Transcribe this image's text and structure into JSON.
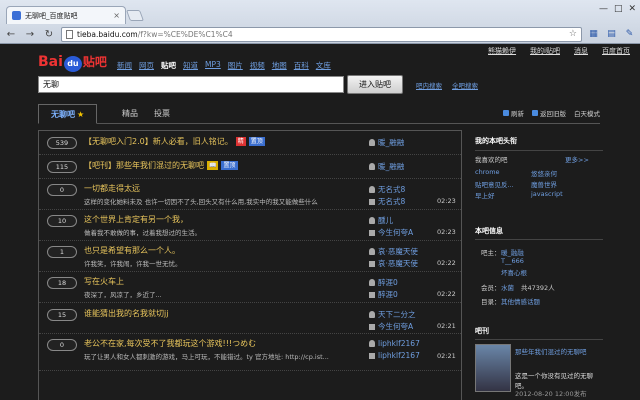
{
  "browser": {
    "tab_title": "无聊吧_百度贴吧",
    "tab_close": "×",
    "url_host": "tieba.baidu.com",
    "url_path": "/f?kw=%CE%DE%C1%C4",
    "win_min": "—",
    "win_max": "□",
    "win_close": "✕",
    "back_glyph": "←",
    "forward_glyph": "→",
    "reload_glyph": "↻",
    "star_glyph": "☆"
  },
  "userbar": [
    "熊猫赖伊",
    "我的i贴吧",
    "消息",
    "百度首页"
  ],
  "logo": {
    "bai": "Bai",
    "du": "du",
    "tieba": "贴吧"
  },
  "nav": [
    "新闻",
    "网页",
    "贴吧",
    "知道",
    "MP3",
    "图片",
    "视频",
    "地图",
    "百科",
    "文库"
  ],
  "nav_current": "贴吧",
  "search": {
    "value": "无聊",
    "button": "进入贴吧",
    "links": [
      "吧内搜索",
      "全吧搜索"
    ]
  },
  "forum_tabs": {
    "active": "无聊吧",
    "star": "★",
    "good": "精品",
    "vote": "投票"
  },
  "tab_tools": [
    "刷新",
    "返回旧版",
    "白天模式"
  ],
  "threads": [
    {
      "count": "539",
      "title": "【无聊吧入门2.0】新人必看，旧人铭记。",
      "tags": [
        {
          "t": "精",
          "c": "red"
        },
        {
          "t": "置顶",
          "c": "blue"
        }
      ],
      "sub": "",
      "author": "暖_融融",
      "reply": "",
      "time": ""
    },
    {
      "count": "115",
      "title": "【吧刊】那些年我们混过的无聊吧",
      "tags": [
        {
          "t": "📖",
          "c": "book"
        },
        {
          "t": "置顶",
          "c": "blue2"
        }
      ],
      "sub": "",
      "author": "暖_融融",
      "reply": "",
      "time": ""
    },
    {
      "count": "0",
      "title": "一切都走得太远",
      "tags": [],
      "sub": "这样的变化她料未及 也许一切因不了头,回头又有什么用,我实中的我又能做些什么",
      "author": "无名式8",
      "reply": "无名式8",
      "time": "02:23"
    },
    {
      "count": "10",
      "title": "这个世界上肯定有另一个我，",
      "tags": [],
      "sub": "做着我不敢做的事，过着我想过的生活。",
      "author": "醺儿",
      "reply": "今生何夸A",
      "time": "02:23"
    },
    {
      "count": "1",
      "title": "也只是希望有那么一个人。",
      "tags": [],
      "sub": "许我笑，许我闹，许我一世无忧。",
      "author": "哀·恶魔天使",
      "reply": "哀·恶魔天使",
      "time": "02:22"
    },
    {
      "count": "18",
      "title": "写在火车上",
      "tags": [],
      "sub": "夜深了，风凉了，乡近了...",
      "author": "醉涯0",
      "reply": "醉涯0",
      "time": "02:22"
    },
    {
      "count": "15",
      "title": "谁能猜出我的名我就切jj",
      "tags": [],
      "sub": "",
      "author": "天下二分之",
      "reply": "今生何夸A",
      "time": "02:21"
    },
    {
      "count": "0",
      "title": "老公不在家,每次受不了我都玩这个游戏!!!つめむ",
      "tags": [],
      "sub": "玩了让男人和女人都刺激的游戏，马上可玩，不能错过。ty 官方地址: http://cp.ist...",
      "author": "liphklf2167",
      "reply": "liphklf2167",
      "time": "02:21"
    }
  ],
  "side": {
    "my_header": "我的本吧头衔",
    "fav_label": "我喜欢的吧",
    "more": "更多>>",
    "favs": [
      "chrome",
      "悠悠亲何",
      "贴吧意见反...",
      "魔兽世界",
      "早上好",
      "javascript"
    ],
    "info_header": "本吧信息",
    "owner_label": "吧主：",
    "owners": [
      "暖_融融",
      "T__666",
      "坏喜心根"
    ],
    "member_label": "会员：",
    "member_name": "水菌",
    "member_count": "共47392人",
    "dir_label": "目录：",
    "dir_value": "其他情感话题",
    "mag_header": "吧刊",
    "mag_title": "那些年我们混过的无聊吧",
    "mag_desc": "这是一个你没有见过的无聊吧。",
    "mag_date": "2012-08-20 12:00发布"
  },
  "colors": {
    "accent_link": "#6f9ee0",
    "title_gold": "#e8c55c",
    "bg": "#1c1c1c"
  }
}
